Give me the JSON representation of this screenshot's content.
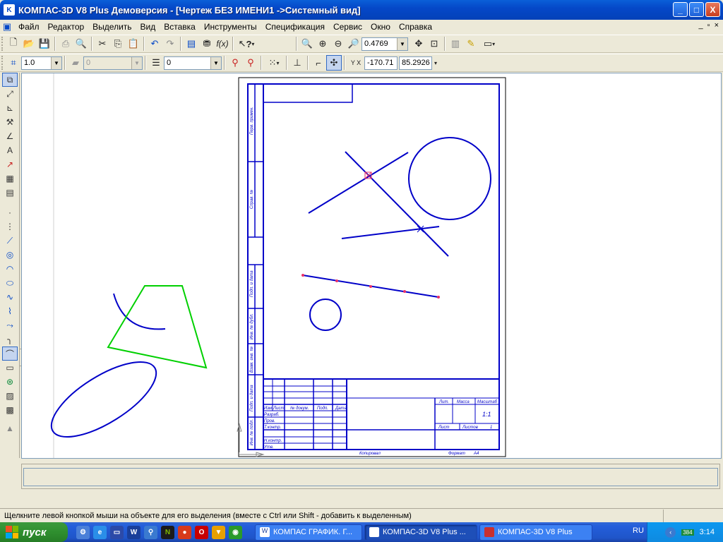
{
  "window": {
    "title": "КОМПАС-3D V8 Plus Демоверсия - [Чертеж БЕЗ ИМЕНИ1 ->Системный вид]",
    "icon_letter": "K",
    "buttons": {
      "minimize": "_",
      "maximize": "□",
      "close": "X"
    }
  },
  "menu": [
    "Файл",
    "Редактор",
    "Выделить",
    "Вид",
    "Вставка",
    "Инструменты",
    "Спецификация",
    "Сервис",
    "Окно",
    "Справка"
  ],
  "doc_controls": [
    "_",
    "▫",
    "×"
  ],
  "toolbar1": {
    "zoom_value": "0.4769",
    "fx_label": "f(x)",
    "help_label": "?"
  },
  "toolbar2": {
    "line_scale": "1.0",
    "layer_disabled": "0",
    "layer_value": "0",
    "coord_label": "Y X",
    "x_value": "-170.71",
    "y_value": "85.2926"
  },
  "drawing_sheet": {
    "side_labels": [
      "Перв. примен.",
      "Справ. №",
      "Подп. и дата",
      "Инв. № дубл.",
      "Взам. инв. №",
      "Подп. и дата",
      "Инв. № подл."
    ],
    "title_block": {
      "row_labels": [
        "Изм.",
        "Лист",
        "№ докум.",
        "Подп.",
        "Дата"
      ],
      "roles": [
        "Разраб.",
        "Пров.",
        "Т.контр.",
        "Н.контр.",
        "Утв."
      ],
      "lit": "Лит.",
      "mass": "Масса",
      "scale": "Масштаб",
      "scale_value": "1:1",
      "sheet": "Лист",
      "sheets": "Листов",
      "sheets_value": "1"
    },
    "bottom_labels": {
      "copied": "Копировал",
      "format": "Формат",
      "format_value": "A4"
    }
  },
  "status": {
    "text": "Щелкните левой кнопкой мыши на объекте для его выделения (вместе с Ctrl или Shift - добавить к выделенным)"
  },
  "taskbar": {
    "start_label": "пуск",
    "tasks": [
      {
        "label": "КОМПАС ГРАФИК. Г...",
        "active": false
      },
      {
        "label": "КОМПАС-3D V8 Plus ...",
        "active": true
      },
      {
        "label": "КОМПАС-3D V8  Plus",
        "active": false
      }
    ],
    "lang": "RU",
    "clock": "3:14",
    "tray_badge": "384"
  },
  "colors": {
    "title_blue": "#0548c8",
    "geometry_blue": "#0000c8",
    "highlight_green": "#00d000",
    "point_red": "#e8306a",
    "taskbar_blue": "#245edb",
    "start_green": "#2f8f2f"
  }
}
